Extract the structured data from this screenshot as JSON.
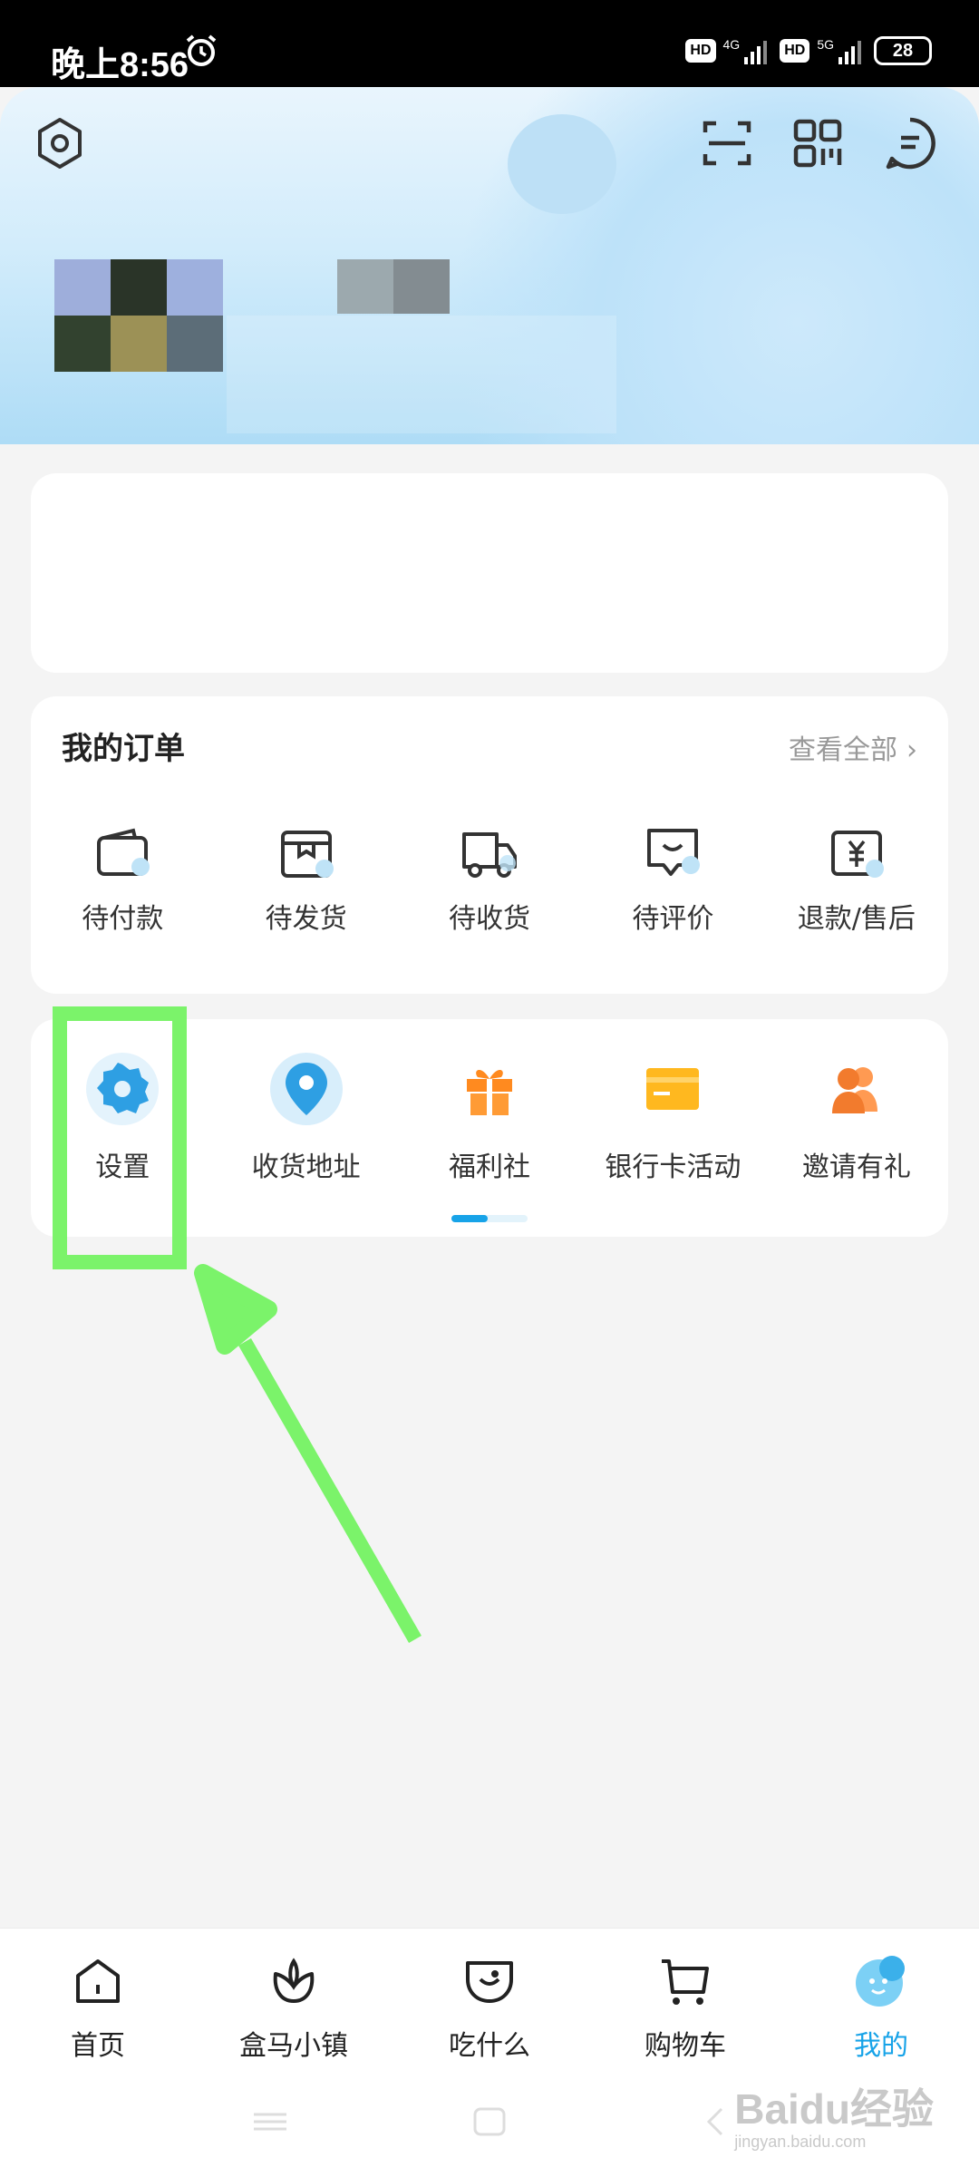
{
  "status_bar": {
    "time": "晚上8:56",
    "hd1": "HD",
    "net1": "4G",
    "hd2": "HD",
    "net2": "5G",
    "battery": "28"
  },
  "header": {
    "icons": [
      "hexagon-settings-icon",
      "scan-icon",
      "qr-code-icon",
      "message-icon"
    ]
  },
  "orders": {
    "title": "我的订单",
    "view_all": "查看全部",
    "items": [
      {
        "label": "待付款",
        "icon": "wallet-icon"
      },
      {
        "label": "待发货",
        "icon": "package-icon"
      },
      {
        "label": "待收货",
        "icon": "truck-icon"
      },
      {
        "label": "待评价",
        "icon": "review-icon"
      },
      {
        "label": "退款/售后",
        "icon": "refund-icon"
      }
    ]
  },
  "tools": {
    "items": [
      {
        "label": "设置",
        "icon": "gear-icon"
      },
      {
        "label": "收货地址",
        "icon": "location-pin-icon"
      },
      {
        "label": "福利社",
        "icon": "gift-icon"
      },
      {
        "label": "银行卡活动",
        "icon": "bank-card-icon"
      },
      {
        "label": "邀请有礼",
        "icon": "invite-friends-icon"
      }
    ]
  },
  "tabbar": {
    "active_index": 4,
    "items": [
      {
        "label": "首页",
        "icon": "home-icon"
      },
      {
        "label": "盒马小镇",
        "icon": "lotus-icon"
      },
      {
        "label": "吃什么",
        "icon": "bowl-icon"
      },
      {
        "label": "购物车",
        "icon": "cart-icon"
      },
      {
        "label": "我的",
        "icon": "mascot-icon"
      }
    ]
  },
  "watermark": {
    "text": "Baidu经验",
    "sub": "jingyan.baidu.com"
  },
  "colors": {
    "accent_blue": "#17a3e8",
    "orange": "#ff8a1f",
    "highlight_green": "#7bf36a"
  }
}
